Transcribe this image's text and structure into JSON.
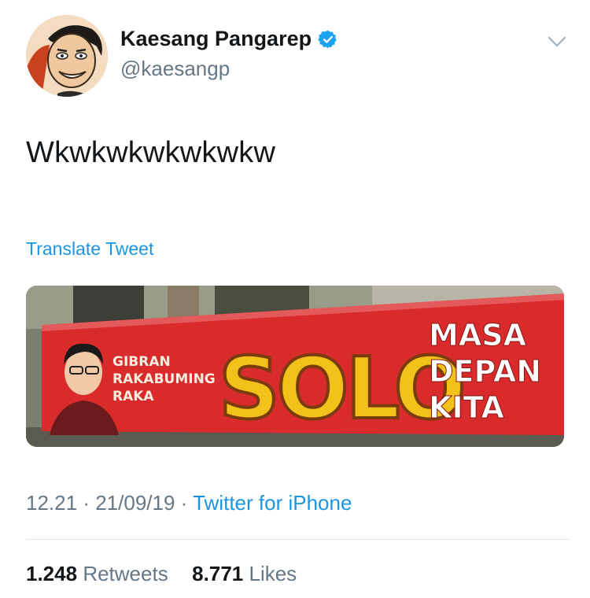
{
  "author": {
    "display_name": "Kaesang Pangarep",
    "handle": "@kaesangp",
    "verified": true
  },
  "tweet": {
    "text": "Wkwkwkwkwkwkw",
    "translate_label": "Translate Tweet"
  },
  "media": {
    "banner": {
      "name_lines": [
        "GIBRAN",
        "RAKABUMING",
        "RAKA"
      ],
      "headline": "SOLO",
      "slogan_lines": [
        "MASA",
        "DEPAN",
        "KITA"
      ]
    }
  },
  "meta": {
    "time": "12.21",
    "date": "21/09/19",
    "separator": "·",
    "source": "Twitter for iPhone"
  },
  "stats": {
    "retweets_count": "1.248",
    "retweets_label": "Retweets",
    "likes_count": "8.771",
    "likes_label": "Likes"
  },
  "colors": {
    "link": "#1b95e0",
    "secondary_text": "#657786",
    "banner_red": "#d92b2b",
    "banner_yellow": "#f2c21b"
  },
  "icons": {
    "verified": "verified-badge-icon",
    "menu": "chevron-down-icon"
  }
}
